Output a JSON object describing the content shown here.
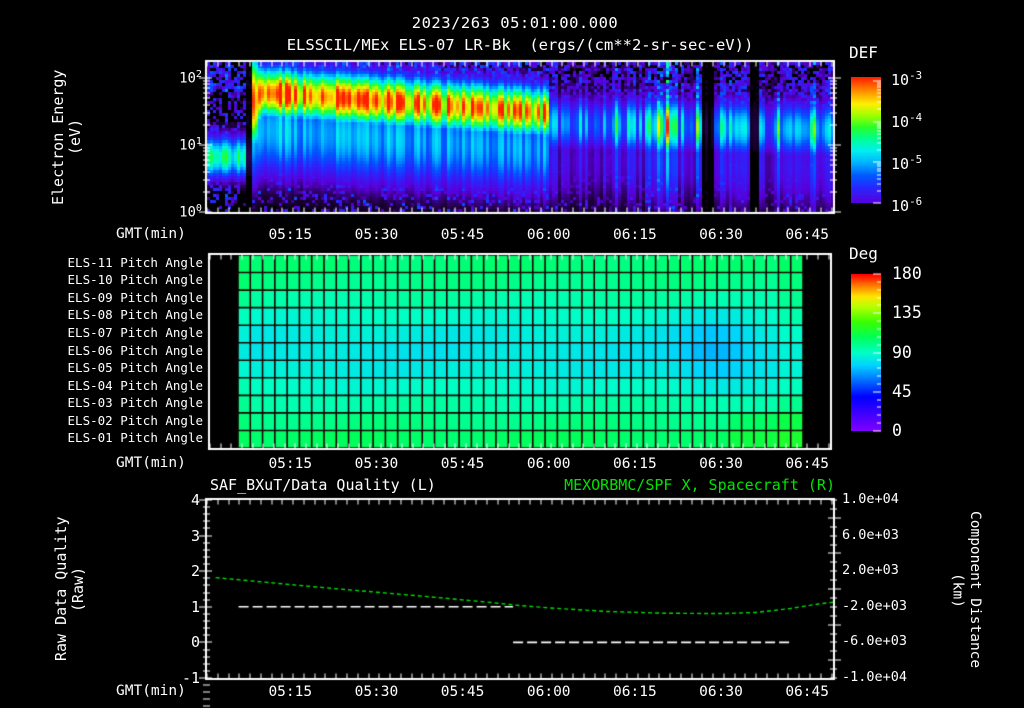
{
  "header": {
    "datetime": "2023/263 05:01:00.000",
    "subtitle": "ELSSCIL/MEx ELS-07 LR-Bk  (ergs/(cm**2-sr-sec-eV))"
  },
  "gmt_label": "GMT(min)",
  "time_axis": {
    "start_min": 300.5,
    "end_min": 409.5,
    "major_ticks": [
      {
        "m": 315,
        "label": "05:15"
      },
      {
        "m": 330,
        "label": "05:30"
      },
      {
        "m": 345,
        "label": "05:45"
      },
      {
        "m": 360,
        "label": "06:00"
      },
      {
        "m": 375,
        "label": "06:15"
      },
      {
        "m": 390,
        "label": "06:30"
      },
      {
        "m": 405,
        "label": "06:45"
      }
    ],
    "minor_step_min": 1.875
  },
  "colorbars": {
    "def": {
      "title": "DEF",
      "ticks": [
        {
          "b": "10",
          "e": "-3"
        },
        {
          "b": "10",
          "e": "-4"
        },
        {
          "b": "10",
          "e": "-5"
        },
        {
          "b": "10",
          "e": "-6"
        }
      ]
    },
    "deg": {
      "title": "Deg",
      "ticks": [
        "180",
        "135",
        "90",
        "45",
        "0"
      ],
      "min": 0,
      "max": 180
    }
  },
  "panels": {
    "top": {
      "y_label1": "Electron Energy",
      "y_label2": "(eV)",
      "y_ticks": [
        {
          "b": "10",
          "e": "2"
        },
        {
          "b": "10",
          "e": "1"
        },
        {
          "b": "10",
          "e": "0"
        }
      ]
    },
    "middle": {
      "row_labels": [
        "ELS-11 Pitch Angle",
        "ELS-10 Pitch Angle",
        "ELS-09 Pitch Angle",
        "ELS-08 Pitch Angle",
        "ELS-07 Pitch Angle",
        "ELS-06 Pitch Angle",
        "ELS-05 Pitch Angle",
        "ELS-04 Pitch Angle",
        "ELS-03 Pitch Angle",
        "ELS-02 Pitch Angle",
        "ELS-01 Pitch Angle"
      ]
    },
    "bottom": {
      "title_left": "SAF_BXuT/Data Quality (L)",
      "title_right": "MEXORBMC/SPF X, Spacecraft (R)",
      "title_right_color": "#00e400",
      "y_left1": "Raw Data Quality",
      "y_left2": "(Raw)",
      "y_right1": "Component Distance",
      "y_right2": "(km)",
      "y_left_ticks": [
        "4",
        "3",
        "2",
        "1",
        "0",
        "-1"
      ],
      "y_right_ticks": [
        "1.0e+04",
        "6.0e+03",
        "2.0e+03",
        "-2.0e+03",
        "-6.0e+03",
        "-1.0e+04"
      ]
    }
  },
  "chart_data": [
    {
      "id": "electron_energy_spectrogram",
      "type": "heatmap",
      "title": "ELSSCIL/MEx ELS-07 LR-Bk",
      "units": "ergs/(cm**2-sr-sec-eV)",
      "x_range_gmt": [
        "05:01",
        "06:49"
      ],
      "ylabel": "Electron Energy (eV)",
      "y_scale": "log",
      "y_range_ev": [
        1,
        170
      ],
      "color_range_def": [
        1e-06,
        0.001
      ],
      "model": {
        "early_low_band": {
          "t_min": [
            300.5,
            308.2
          ],
          "center_logE": 0.82,
          "sigma": 0.22,
          "peak": 0.55
        },
        "gap_min": [
          307.3,
          308.2
        ],
        "injection_stripe": {
          "t_min": [
            308.2,
            309.6
          ],
          "center_logE": 1.65,
          "sigma": 0.5,
          "peak": 0.95
        },
        "main_band": {
          "t_min": [
            310,
            360
          ],
          "center_logE": [
            1.78,
            1.48
          ],
          "peak": [
            0.93,
            0.86
          ],
          "sigma": 0.27
        },
        "late_band": {
          "t_min": [
            360,
            409.5
          ],
          "center_logE": [
            1.32,
            1.22
          ],
          "peak": 0.52,
          "sigma": 0.3,
          "dropouts_min": [
            [
              386.5,
              388.8
            ],
            [
              394.8,
              396.6
            ]
          ],
          "bright_min": [
            [
              377,
              382
            ],
            [
              391.5,
              394
            ],
            [
              405.5,
              409.5
            ]
          ]
        }
      }
    },
    {
      "id": "pitch_angle_grid",
      "type": "heatmap",
      "rows": [
        "ELS-11",
        "ELS-10",
        "ELS-09",
        "ELS-08",
        "ELS-07",
        "ELS-06",
        "ELS-05",
        "ELS-04",
        "ELS-03",
        "ELS-02",
        "ELS-01"
      ],
      "row_mean_deg": [
        103,
        100,
        95,
        89,
        84,
        82,
        84,
        89,
        95,
        101,
        106
      ],
      "n_time_columns": 46,
      "x_range_gmt": [
        "05:06",
        "06:44"
      ],
      "color_range_deg": [
        0,
        180
      ],
      "anomaly": {
        "gmt": "06:28",
        "center_col": 38.4,
        "sigma_cols": 2.2,
        "row_deg_drop": [
          0,
          0,
          0,
          5,
          10,
          13,
          11,
          6,
          0,
          0,
          0
        ]
      }
    },
    {
      "id": "quality_and_spacecraft_x",
      "type": "line",
      "y_left_range": [
        -1,
        4
      ],
      "y_right_range": [
        -10000,
        10000
      ],
      "series": [
        {
          "name": "SAF_BXuT/Data Quality (L)",
          "axis": "left",
          "color": "#ffffff",
          "style": "dashed",
          "segments": [
            {
              "value": 1,
              "start_min": 306,
              "end_min": 353.8,
              "start_gmt": "05:06",
              "end_gmt": "05:54"
            },
            {
              "value": 0,
              "start_min": 353.8,
              "end_min": 402,
              "start_gmt": "05:54",
              "end_gmt": "06:42"
            }
          ]
        },
        {
          "name": "MEXORBMC/SPF X, Spacecraft (R)",
          "axis": "right",
          "color": "#00dc00",
          "style": "dashed",
          "x_min": [
            302,
            310,
            320,
            330,
            340,
            350,
            354,
            360,
            370,
            380,
            390,
            396,
            402,
            407,
            409.5
          ],
          "y_left_scale": [
            1.82,
            1.7,
            1.55,
            1.41,
            1.27,
            1.12,
            1.05,
            0.97,
            0.87,
            0.82,
            0.81,
            0.84,
            0.95,
            1.08,
            1.13
          ],
          "y_right_km": [
            1280,
            800,
            200,
            -360,
            -920,
            -1520,
            -1800,
            -2120,
            -2520,
            -2720,
            -2760,
            -2640,
            -2200,
            -1680,
            -1480
          ]
        }
      ]
    }
  ]
}
